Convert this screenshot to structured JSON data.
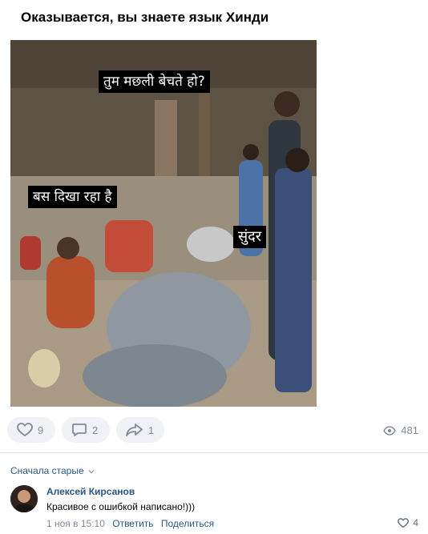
{
  "post": {
    "title": "Оказывается, вы знаете язык Хинди",
    "captions": {
      "top": "तुम मछली बेचते हो?",
      "left": "बस दिखा रहा है",
      "right": "सुंदर"
    }
  },
  "actions": {
    "likes": "9",
    "comments": "2",
    "shares": "1",
    "views": "481"
  },
  "comments": {
    "sort_label": "Сначала старые",
    "items": [
      {
        "author": "Алексей Кирсанов",
        "text": "Красивое с ошибкой написано!)))",
        "time": "1 ноя в 15:10",
        "reply_label": "Ответить",
        "share_label": "Поделиться",
        "likes": "4"
      }
    ]
  },
  "colors": {
    "link": "#2a5885",
    "muted": "#818c99",
    "pill_bg": "#f0f2f5"
  }
}
